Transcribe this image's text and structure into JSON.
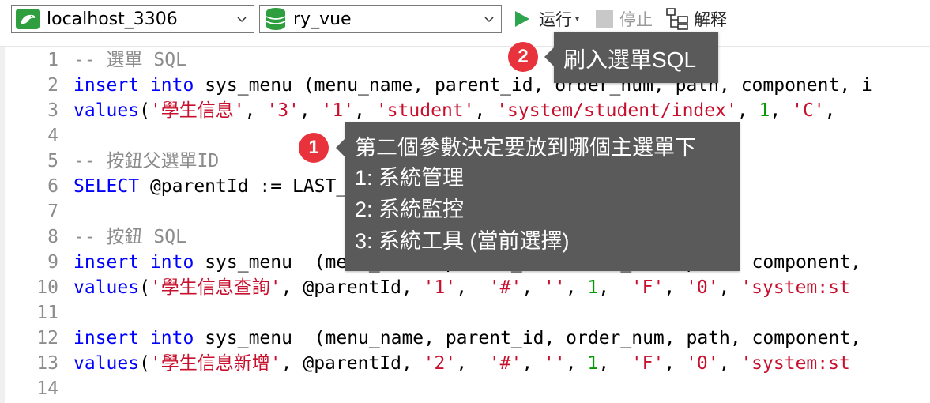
{
  "toolbar": {
    "connection": "localhost_3306",
    "database": "ry_vue",
    "run_label": "运行",
    "stop_label": "停止",
    "explain_label": "解释"
  },
  "editor": {
    "lines": [
      {
        "n": "1",
        "tokens": [
          [
            "cmt",
            "-- 選單 SQL"
          ]
        ]
      },
      {
        "n": "2",
        "tokens": [
          [
            "kw",
            "insert"
          ],
          [
            "p",
            " "
          ],
          [
            "kw",
            "into"
          ],
          [
            "p",
            " sys_menu (menu_name, parent_id, order_num, path, component, i"
          ]
        ]
      },
      {
        "n": "3",
        "tokens": [
          [
            "kw",
            "values"
          ],
          [
            "p",
            "("
          ],
          [
            "str",
            "'學生信息'"
          ],
          [
            "p",
            ", "
          ],
          [
            "str",
            "'3'"
          ],
          [
            "p",
            ", "
          ],
          [
            "str",
            "'1'"
          ],
          [
            "p",
            ", "
          ],
          [
            "str",
            "'student'"
          ],
          [
            "p",
            ", "
          ],
          [
            "str",
            "'system/student/index'"
          ],
          [
            "p",
            ", "
          ],
          [
            "num",
            "1"
          ],
          [
            "p",
            ", "
          ],
          [
            "str",
            "'C'"
          ],
          [
            "p",
            ","
          ]
        ]
      },
      {
        "n": "4",
        "tokens": []
      },
      {
        "n": "5",
        "tokens": [
          [
            "cmt",
            "-- 按鈕父選單ID"
          ]
        ]
      },
      {
        "n": "6",
        "tokens": [
          [
            "kw",
            "SELECT"
          ],
          [
            "p",
            " @parentId := LAST_INSERT_ID();"
          ]
        ]
      },
      {
        "n": "7",
        "tokens": []
      },
      {
        "n": "8",
        "tokens": [
          [
            "cmt",
            "-- 按鈕 SQL"
          ]
        ]
      },
      {
        "n": "9",
        "tokens": [
          [
            "kw",
            "insert"
          ],
          [
            "p",
            " "
          ],
          [
            "kw",
            "into"
          ],
          [
            "p",
            " sys_menu  (menu_name, parent_id, order_num, path, component,"
          ]
        ]
      },
      {
        "n": "10",
        "tokens": [
          [
            "kw",
            "values"
          ],
          [
            "p",
            "("
          ],
          [
            "str",
            "'學生信息查詢'"
          ],
          [
            "p",
            ", @parentId, "
          ],
          [
            "str",
            "'1'"
          ],
          [
            "p",
            ",  "
          ],
          [
            "str",
            "'#'"
          ],
          [
            "p",
            ", "
          ],
          [
            "str",
            "''"
          ],
          [
            "p",
            ", "
          ],
          [
            "num",
            "1"
          ],
          [
            "p",
            ",  "
          ],
          [
            "str",
            "'F'"
          ],
          [
            "p",
            ", "
          ],
          [
            "str",
            "'0'"
          ],
          [
            "p",
            ", "
          ],
          [
            "str",
            "'system:st"
          ]
        ]
      },
      {
        "n": "11",
        "tokens": []
      },
      {
        "n": "12",
        "tokens": [
          [
            "kw",
            "insert"
          ],
          [
            "p",
            " "
          ],
          [
            "kw",
            "into"
          ],
          [
            "p",
            " sys_menu  (menu_name, parent_id, order_num, path, component,"
          ]
        ]
      },
      {
        "n": "13",
        "tokens": [
          [
            "kw",
            "values"
          ],
          [
            "p",
            "("
          ],
          [
            "str",
            "'學生信息新增'"
          ],
          [
            "p",
            ", @parentId, "
          ],
          [
            "str",
            "'2'"
          ],
          [
            "p",
            ",  "
          ],
          [
            "str",
            "'#'"
          ],
          [
            "p",
            ", "
          ],
          [
            "str",
            "''"
          ],
          [
            "p",
            ", "
          ],
          [
            "num",
            "1"
          ],
          [
            "p",
            ",  "
          ],
          [
            "str",
            "'F'"
          ],
          [
            "p",
            ", "
          ],
          [
            "str",
            "'0'"
          ],
          [
            "p",
            ", "
          ],
          [
            "str",
            "'system:st"
          ]
        ]
      },
      {
        "n": "14",
        "tokens": []
      }
    ]
  },
  "callouts": {
    "first": {
      "badge": "1",
      "lines": [
        "第二個參數決定要放到哪個主選單下",
        "1: 系統管理",
        "2: 系統監控",
        "3: 系統工具 (當前選擇)"
      ]
    },
    "second": {
      "badge": "2",
      "text": "刷入選單SQL"
    }
  },
  "colors": {
    "keyword": "#0000ff",
    "string": "#c8102e",
    "number": "#009900",
    "comment": "#8c8c8c",
    "callout_bg": "#5a5a5a",
    "badge_bg": "#e8323c",
    "run_icon": "#2ea44f",
    "db_icon": "#2e9e3e"
  },
  "icons": {
    "connection": "mysql-dolphin-icon",
    "database": "database-cylinder-icon",
    "run": "play-icon",
    "stop": "stop-square-icon",
    "explain": "explain-icon"
  }
}
